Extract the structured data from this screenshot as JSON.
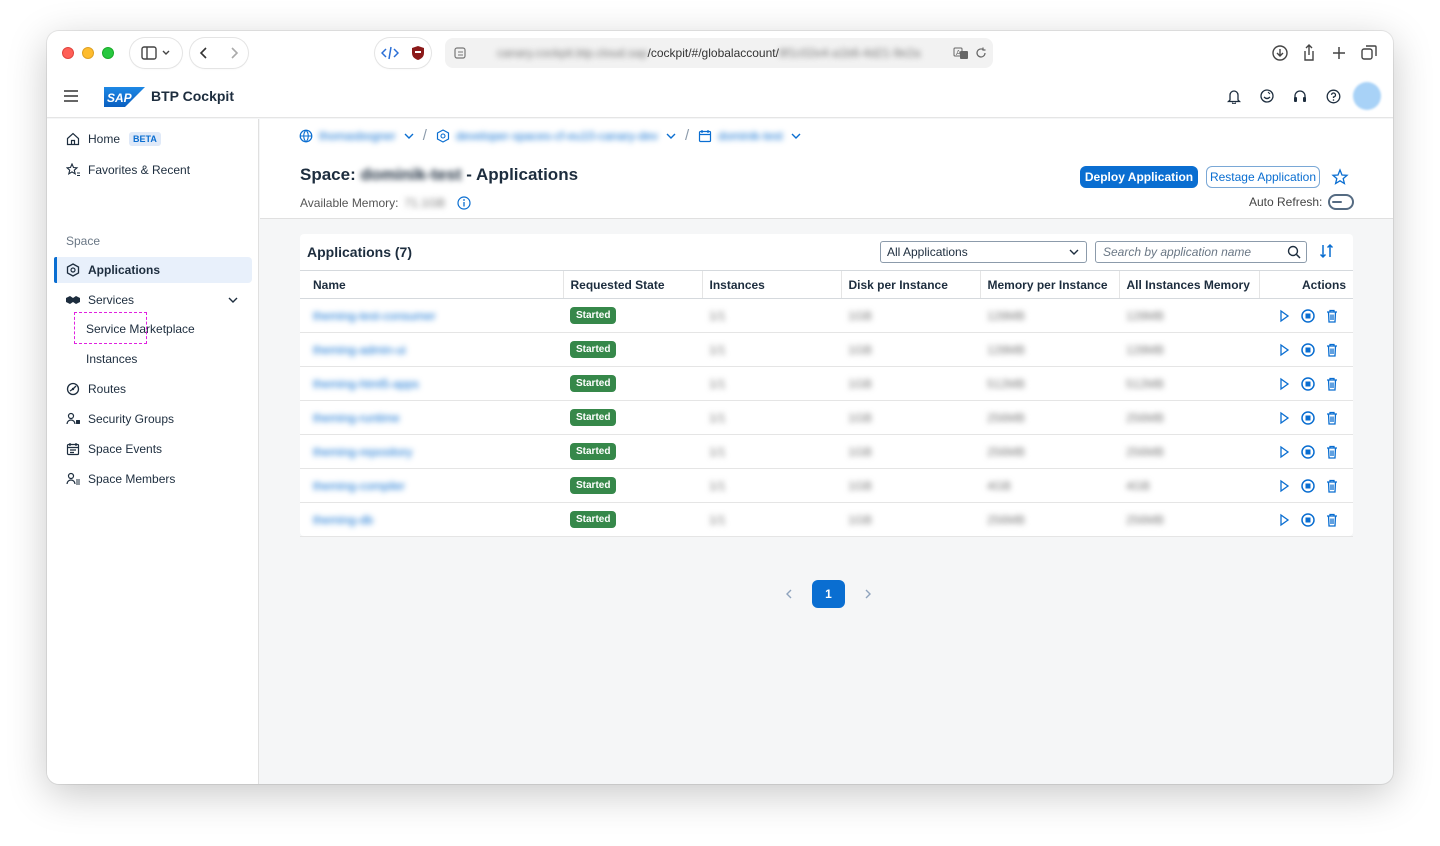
{
  "browser": {
    "url_visible": "/cockpit/#/globalaccount/",
    "url_blurred_prefix": "canary.cockpit.btp.cloud.sap",
    "url_blurred_suffix": "8f1c02e4-a1b6-4d21-9e2a"
  },
  "shell": {
    "product": "BTP Cockpit",
    "logo_text": "SAP"
  },
  "sidebar": {
    "home": "Home",
    "home_badge": "BETA",
    "favorites": "Favorites & Recent",
    "section": "Space",
    "applications": "Applications",
    "services": "Services",
    "service_marketplace": "Service Marketplace",
    "instances": "Instances",
    "routes": "Routes",
    "security_groups": "Security Groups",
    "space_events": "Space Events",
    "space_members": "Space Members"
  },
  "breadcrumb": {
    "item1": "thomasbogner",
    "item2": "developer-spaces-cf-eu10-canary-dev",
    "item3": "dominik-test"
  },
  "header": {
    "title_prefix": "Space: ",
    "space_name": "dominik-test",
    "title_suffix": " - Applications",
    "memory_label": "Available Memory:",
    "memory_value": "71.1GB",
    "deploy": "Deploy Application",
    "restage": "Restage Application",
    "auto_refresh": "Auto Refresh:"
  },
  "table": {
    "title": "Applications (7)",
    "filter_value": "All Applications",
    "search_placeholder": "Search by application name",
    "columns": [
      "Name",
      "Requested State",
      "Instances",
      "Disk per Instance",
      "Memory per Instance",
      "All Instances Memory",
      "Actions"
    ],
    "rows": [
      {
        "name": "theming-test-consumer",
        "state": "Started",
        "instances": "1/1",
        "disk": "1GB",
        "memory": "128MB",
        "all_memory": "128MB"
      },
      {
        "name": "theming-admin-ui",
        "state": "Started",
        "instances": "1/1",
        "disk": "1GB",
        "memory": "128MB",
        "all_memory": "128MB"
      },
      {
        "name": "theming-html5-apps",
        "state": "Started",
        "instances": "1/1",
        "disk": "1GB",
        "memory": "512MB",
        "all_memory": "512MB"
      },
      {
        "name": "theming-runtime",
        "state": "Started",
        "instances": "1/1",
        "disk": "1GB",
        "memory": "256MB",
        "all_memory": "256MB"
      },
      {
        "name": "theming-repository",
        "state": "Started",
        "instances": "1/1",
        "disk": "1GB",
        "memory": "256MB",
        "all_memory": "256MB"
      },
      {
        "name": "theming-compiler",
        "state": "Started",
        "instances": "1/1",
        "disk": "1GB",
        "memory": "4GB",
        "all_memory": "4GB"
      },
      {
        "name": "theming-db",
        "state": "Started",
        "instances": "1/1",
        "disk": "1GB",
        "memory": "256MB",
        "all_memory": "256MB"
      }
    ]
  },
  "pagination": {
    "current": "1"
  },
  "colors": {
    "accent": "#0a6ed1",
    "status_started": "#36884a",
    "highlight": "#e020e0"
  }
}
